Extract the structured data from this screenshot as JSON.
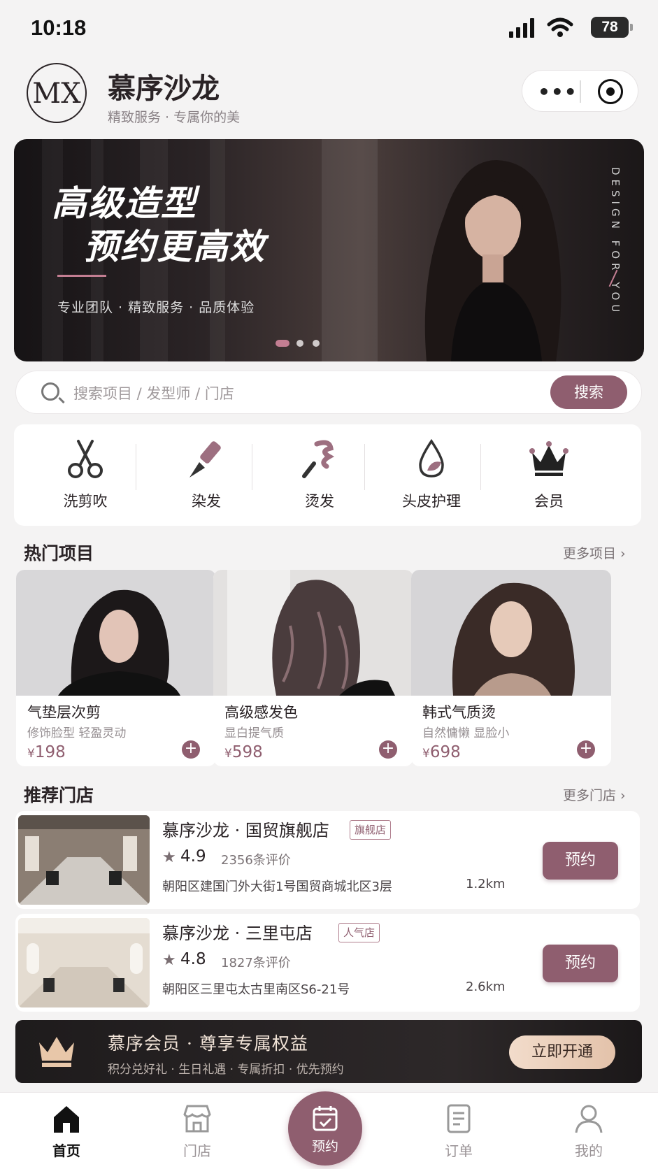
{
  "status_bar": {
    "time": "10:18",
    "battery": "78"
  },
  "header": {
    "logo": "MX",
    "brand": "慕序沙龙",
    "slogan": "精致服务 · 专属你的美",
    "capsule_dots": "•••"
  },
  "banner": {
    "title_line1": "高级造型",
    "title_line2": "预约更高效",
    "subtitle": "专业团队 · 精致服务 · 品质体验",
    "vertical_text": "DESIGN FOR YOU",
    "active_slide": 1,
    "slide_count": 3
  },
  "search": {
    "placeholder": "搜索项目 / 发型师 / 门店",
    "button": "搜索"
  },
  "categories": [
    {
      "label": "洗剪吹",
      "icon": "scissors-icon"
    },
    {
      "label": "染发",
      "icon": "dye-brush-icon"
    },
    {
      "label": "烫发",
      "icon": "curling-iron-icon"
    },
    {
      "label": "头皮护理",
      "icon": "droplet-leaf-icon"
    },
    {
      "label": "会员",
      "icon": "crown-icon"
    }
  ],
  "hot": {
    "title": "热门项目",
    "more": "更多项目 ›",
    "items": [
      {
        "name": "气垫层次剪",
        "desc": "修饰脸型 轻盈灵动",
        "currency": "¥",
        "price": "198"
      },
      {
        "name": "高级感发色",
        "desc": "显白提气质",
        "currency": "¥",
        "price": "598"
      },
      {
        "name": "韩式气质烫",
        "desc": "自然慵懒 显脸小",
        "currency": "¥",
        "price": "698"
      }
    ]
  },
  "stores": {
    "title": "推荐门店",
    "more": "更多门店 ›",
    "items": [
      {
        "name": "慕序沙龙 · 国贸旗舰店",
        "tag": "旗舰店",
        "star": "★",
        "rating": "4.9",
        "reviews": "2356条评价",
        "address": "朝阳区建国门外大街1号国贸商城北区3层",
        "distance": "1.2km",
        "book": "预约"
      },
      {
        "name": "慕序沙龙 · 三里屯店",
        "tag": "人气店",
        "star": "★",
        "rating": "4.8",
        "reviews": "1827条评价",
        "address": "朝阳区三里屯太古里南区S6-21号",
        "distance": "2.6km",
        "book": "预约"
      }
    ]
  },
  "member": {
    "title": "慕序会员 · 尊享专属权益",
    "subtitle": "积分兑好礼 · 生日礼遇 · 专属折扣 · 优先预约",
    "button": "立即开通"
  },
  "tabbar": [
    {
      "label": "首页",
      "icon": "home-icon"
    },
    {
      "label": "门店",
      "icon": "store-icon"
    },
    {
      "label": "预约",
      "icon": "calendar-check-icon"
    },
    {
      "label": "订单",
      "icon": "order-icon"
    },
    {
      "label": "我的",
      "icon": "user-icon"
    }
  ],
  "colors": {
    "accent": "#8f5e6f",
    "dark": "#2a2326",
    "gold": "#e3c2aa"
  }
}
